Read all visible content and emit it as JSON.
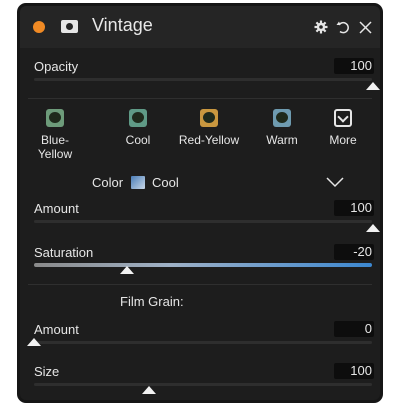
{
  "panel": {
    "title": "Vintage",
    "accent_color": "#f08a24",
    "header_icons": [
      "gear-icon",
      "reset-icon",
      "close-icon"
    ]
  },
  "opacity": {
    "label": "Opacity",
    "value": "100",
    "level": 1.0
  },
  "presets": [
    {
      "label": "Blue-Yellow",
      "swatch": "#6d9b7a"
    },
    {
      "label": "Cool",
      "swatch": "#5f9a86"
    },
    {
      "label": "Red-Yellow",
      "swatch": "#c9973f"
    },
    {
      "label": "Warm",
      "swatch": "#6e9bb0"
    },
    {
      "label": "More",
      "icon": "chevron-down-box-icon"
    }
  ],
  "color": {
    "label": "Color",
    "value": "Cool"
  },
  "amount": {
    "label": "Amount",
    "value": "100",
    "level": 1.0
  },
  "saturation": {
    "label": "Saturation",
    "value": "-20",
    "level": 0.3
  },
  "film_grain": {
    "heading": "Film Grain:",
    "amount": {
      "label": "Amount",
      "value": "0",
      "level": 0.0
    },
    "size": {
      "label": "Size",
      "value": "100",
      "level": 0.33
    }
  }
}
